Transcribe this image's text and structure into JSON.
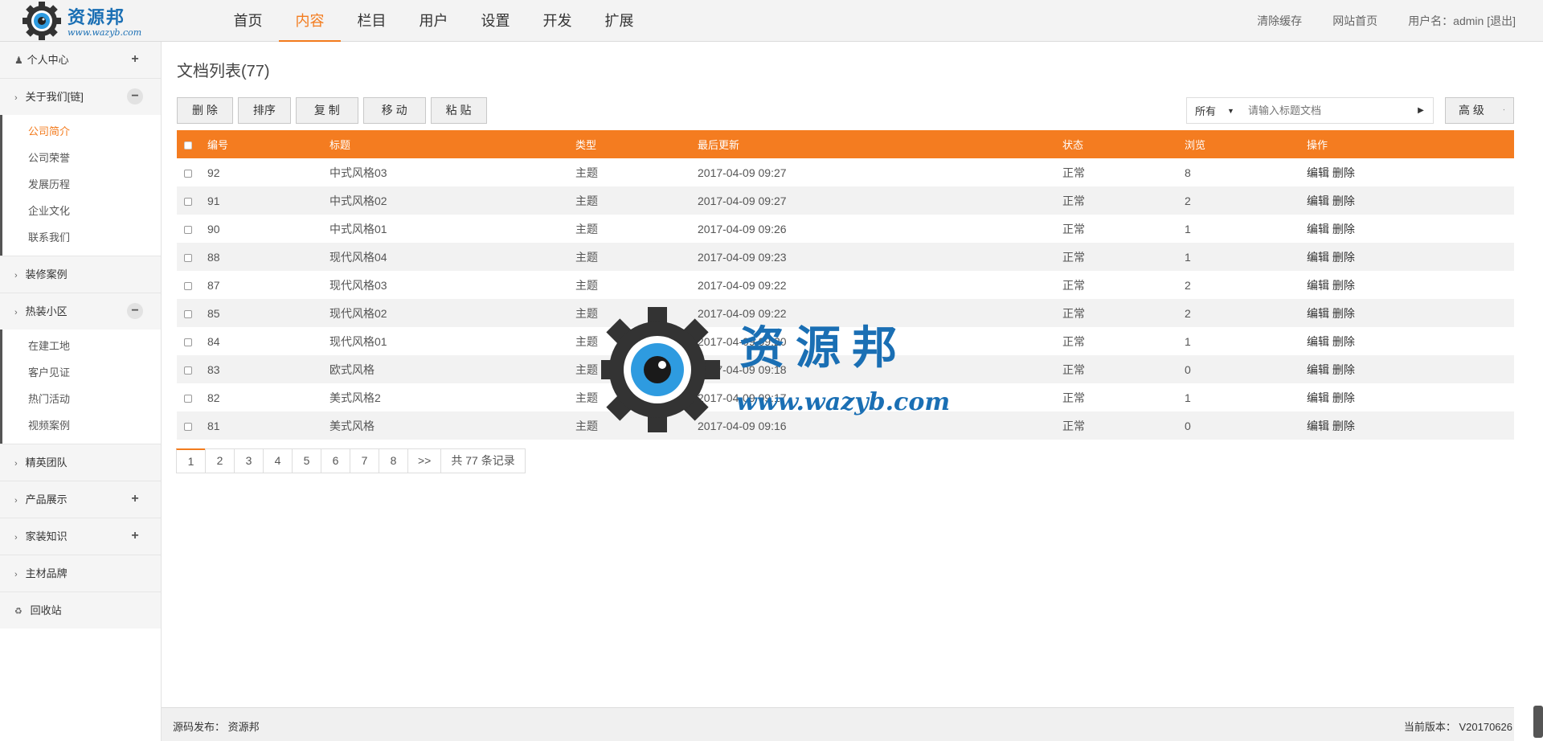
{
  "logo": {
    "brand": "资源邦",
    "url": "www.wazyb.com"
  },
  "nav": [
    {
      "label": "首页"
    },
    {
      "label": "内容"
    },
    {
      "label": "栏目"
    },
    {
      "label": "用户"
    },
    {
      "label": "设置"
    },
    {
      "label": "开发"
    },
    {
      "label": "扩展"
    }
  ],
  "header_right": {
    "clear_cache": "清除缓存",
    "site_home": "网站首页",
    "user": "用户名：admin [退出]"
  },
  "sidebar": {
    "personal": "个人中心",
    "groups": [
      {
        "label": "关于我们[链]",
        "items": [
          "公司简介",
          "公司荣誉",
          "发展历程",
          "企业文化",
          "联系我们"
        ]
      },
      {
        "label": "装修案例"
      },
      {
        "label": "热装小区",
        "items": [
          "在建工地",
          "客户见证",
          "热门活动",
          "视频案例"
        ]
      },
      {
        "label": "精英团队"
      },
      {
        "label": "产品展示"
      },
      {
        "label": "家装知识"
      },
      {
        "label": "主材品牌"
      }
    ],
    "recycle": "回收站"
  },
  "main": {
    "title": "文档列表(77)",
    "toolbar": [
      "删 除",
      "排序",
      "复 制",
      "移 动",
      "粘 贴"
    ],
    "search": {
      "select": "所有",
      "placeholder": "请输入标题文档"
    },
    "advanced": "高 级",
    "columns": [
      "编号",
      "标题",
      "类型",
      "最后更新",
      "状态",
      "浏览",
      "操作"
    ],
    "rows": [
      {
        "id": "92",
        "title": "中式风格03",
        "type": "主题",
        "updated": "2017-04-09 09:27",
        "status": "正常",
        "views": "8"
      },
      {
        "id": "91",
        "title": "中式风格02",
        "type": "主题",
        "updated": "2017-04-09 09:27",
        "status": "正常",
        "views": "2"
      },
      {
        "id": "90",
        "title": "中式风格01",
        "type": "主题",
        "updated": "2017-04-09 09:26",
        "status": "正常",
        "views": "1"
      },
      {
        "id": "88",
        "title": "现代风格04",
        "type": "主题",
        "updated": "2017-04-09 09:23",
        "status": "正常",
        "views": "1"
      },
      {
        "id": "87",
        "title": "现代风格03",
        "type": "主题",
        "updated": "2017-04-09 09:22",
        "status": "正常",
        "views": "2"
      },
      {
        "id": "85",
        "title": "现代风格02",
        "type": "主题",
        "updated": "2017-04-09 09:22",
        "status": "正常",
        "views": "2"
      },
      {
        "id": "84",
        "title": "现代风格01",
        "type": "主题",
        "updated": "2017-04-09 09:20",
        "status": "正常",
        "views": "1"
      },
      {
        "id": "83",
        "title": "欧式风格",
        "type": "主题",
        "updated": "2017-04-09 09:18",
        "status": "正常",
        "views": "0"
      },
      {
        "id": "82",
        "title": "美式风格2",
        "type": "主题",
        "updated": "2017-04-09 09:17",
        "status": "正常",
        "views": "1"
      },
      {
        "id": "81",
        "title": "美式风格",
        "type": "主题",
        "updated": "2017-04-09 09:16",
        "status": "正常",
        "views": "0"
      }
    ],
    "row_actions": {
      "edit": "编辑",
      "delete": "删除"
    },
    "pager": {
      "pages": [
        "1",
        "2",
        "3",
        "4",
        "5",
        "6",
        "7",
        "8"
      ],
      "next": ">>",
      "total": "共 77 条记录"
    }
  },
  "footer": {
    "left": "源码发布：  资源邦",
    "right": "当前版本：  V20170626"
  },
  "watermark": {
    "brand": "资源邦",
    "url": "www.wazyb.com"
  },
  "colors": {
    "accent": "#f47c20",
    "brand_blue": "#1a6fb4"
  }
}
